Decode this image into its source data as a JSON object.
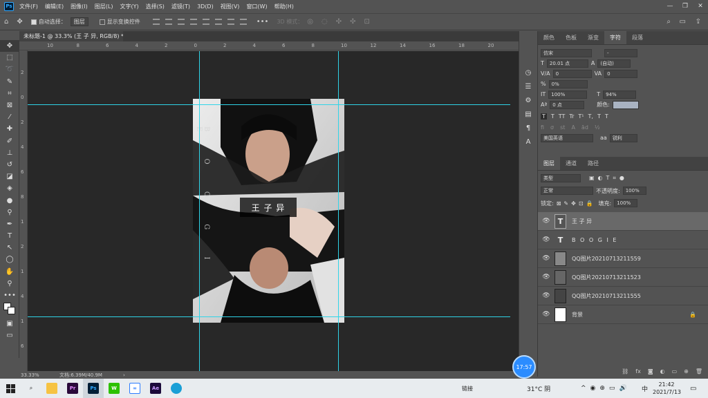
{
  "app": {
    "logo": "Ps"
  },
  "menu": [
    "文件(F)",
    "编辑(E)",
    "图像(I)",
    "图层(L)",
    "文字(Y)",
    "选择(S)",
    "滤镜(T)",
    "3D(D)",
    "视图(V)",
    "窗口(W)",
    "帮助(H)"
  ],
  "window_controls": [
    "—",
    "❐",
    "✕"
  ],
  "options": {
    "auto_select_label": "自动选择：",
    "auto_select_value": "图层",
    "show_transform_label": "显示变换控件",
    "mode_3d": "3D 模式："
  },
  "document": {
    "tab_title": "未标题-1 @ 33.3% (王 子 异, RGB/8) *",
    "zoom": "33.33%",
    "doc_info": "文档:6.39M/40.9M",
    "overlay_title": "王 子 异",
    "vertical_text": "B O O G I E"
  },
  "ruler_h": [
    "10",
    "8",
    "6",
    "4",
    "2",
    "0",
    "2",
    "4",
    "6",
    "8",
    "10",
    "12",
    "14",
    "16",
    "18",
    "20"
  ],
  "ruler_v": [
    "2",
    "0",
    "2",
    "4",
    "6",
    "8",
    "1",
    "2",
    "1",
    "4",
    "1",
    "6"
  ],
  "char_panel": {
    "tabs": [
      "颜色",
      "色板",
      "渐变",
      "字符",
      "段落"
    ],
    "font_family": "仿宋",
    "font_style": "-",
    "size": "20.01 点",
    "leading": "(自动)",
    "kerning": "0",
    "tracking": "0",
    "scale_label": "0%",
    "vscale": "100%",
    "hscale": "94%",
    "baseline": "0 点",
    "color_label": "颜色:",
    "type_styles": [
      "T",
      "T",
      "TT",
      "Tr",
      "T¹",
      "T,",
      "T",
      "T"
    ],
    "language": "美国英语",
    "aa": "锐利",
    "color_swatch": "#a9b3c2"
  },
  "layers_panel": {
    "tabs": [
      "图层",
      "通道",
      "路径"
    ],
    "filter": "类型",
    "blend": "正常",
    "opacity_label": "不透明度:",
    "opacity": "100%",
    "lock_label": "锁定:",
    "fill_label": "填充:",
    "fill": "100%",
    "layers": [
      {
        "name": "王 子 异",
        "type": "text",
        "selected": true
      },
      {
        "name": "B O O G I E",
        "type": "text",
        "selected": false
      },
      {
        "name": "QQ图片20210713211559",
        "type": "image",
        "selected": false
      },
      {
        "name": "QQ图片20210713211523",
        "type": "image",
        "selected": false
      },
      {
        "name": "QQ图片20210713211555",
        "type": "image",
        "selected": false
      },
      {
        "name": "背景",
        "type": "bg",
        "selected": false
      }
    ]
  },
  "timer": "17:57",
  "taskbar": {
    "notes": "链接",
    "weather": "31°C 阴",
    "ime": "中",
    "time": "21:42",
    "date": "2021/7/13"
  },
  "colors": {
    "guide": "#2fd4e8",
    "canvas_bg": "#282828",
    "ui_bg": "#535353"
  }
}
